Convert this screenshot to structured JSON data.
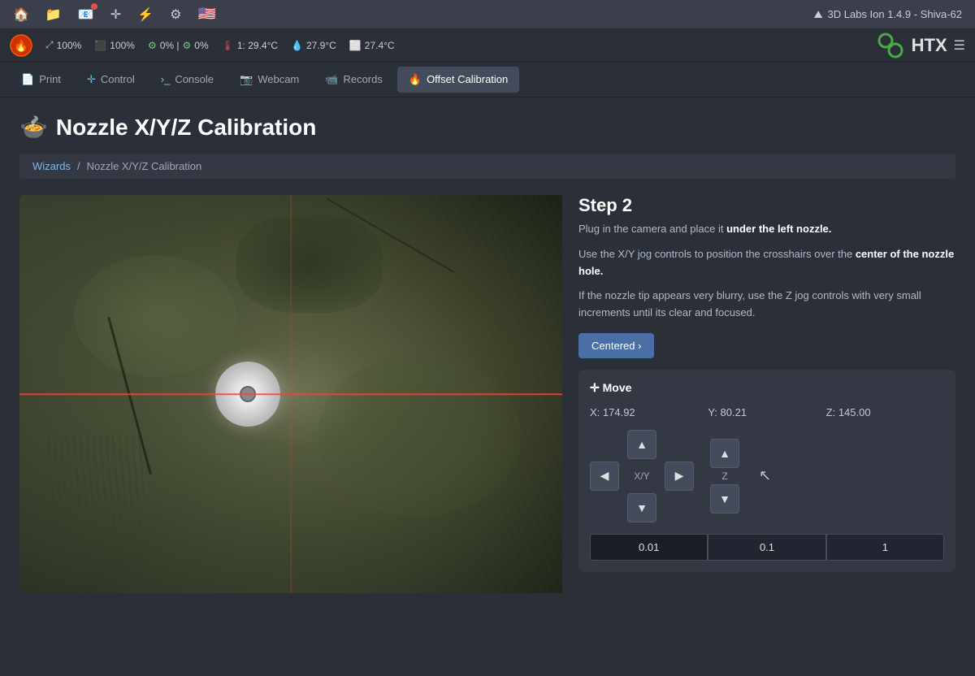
{
  "app": {
    "title": "3D Labs Ion 1.4.9 - Shiva-62"
  },
  "topbar": {
    "icons": [
      "home",
      "file",
      "mail",
      "crosshair",
      "bolt",
      "gear",
      "flag"
    ]
  },
  "statusbar": {
    "items": [
      {
        "icon": "🔥",
        "label": "100%"
      },
      {
        "icon": "⬛",
        "label": "100%"
      },
      {
        "icon": "⚙",
        "label": "0% | ⚙ 0%"
      },
      {
        "icon": "🌡",
        "label": "1: 29.4°C"
      },
      {
        "icon": "💧",
        "label": "27.9°C"
      },
      {
        "icon": "🔲",
        "label": "27.4°C"
      }
    ],
    "logo_text": "HTX"
  },
  "tabs": [
    {
      "id": "print",
      "label": "Print",
      "icon": "📄",
      "active": false
    },
    {
      "id": "control",
      "label": "Control",
      "icon": "➕",
      "active": false
    },
    {
      "id": "console",
      "label": "Console",
      "icon": ">_",
      "active": false
    },
    {
      "id": "webcam",
      "label": "Webcam",
      "icon": "📷",
      "active": false
    },
    {
      "id": "records",
      "label": "Records",
      "icon": "📹",
      "active": false
    },
    {
      "id": "offset-calibration",
      "label": "Offset Calibration",
      "icon": "🔥",
      "active": true
    }
  ],
  "page": {
    "title": "Nozzle X/Y/Z Calibration",
    "title_icon": "🍲"
  },
  "breadcrumb": {
    "items": [
      "Wizards",
      "Nozzle X/Y/Z Calibration"
    ],
    "separator": "/"
  },
  "step": {
    "number": "Step 2",
    "instructions": [
      "Plug in the camera and place it under the left nozzle.",
      "Use the X/Y jog controls to position the crosshairs over the center of the nozzle hole.",
      "If the nozzle tip appears very blurry, use the Z jog controls with very small increments until its clear and focused."
    ],
    "centered_button": "Centered ›"
  },
  "move": {
    "title": "✛ Move",
    "x": "X: 174.92",
    "y": "Y: 80.21",
    "z": "Z: 145.00",
    "xy_label": "X/Y",
    "z_label": "Z",
    "increments": [
      "0.01",
      "0.1",
      "1"
    ]
  }
}
